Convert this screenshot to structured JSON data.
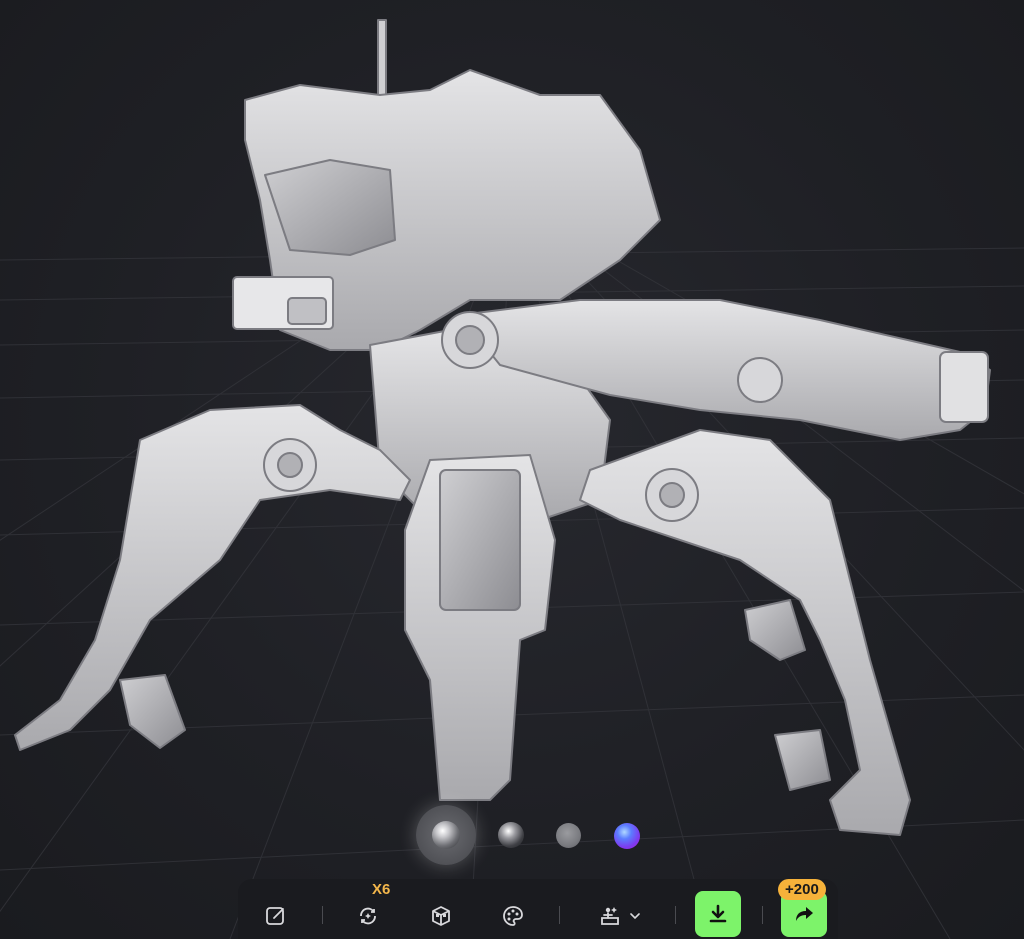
{
  "viewer": {
    "background_color": "#1f2025",
    "grid_color": "#2f3036"
  },
  "materials": [
    {
      "name": "clay",
      "icon": "clay-sphere-icon",
      "active": true
    },
    {
      "name": "metal",
      "icon": "metal-sphere-icon",
      "active": false
    },
    {
      "name": "matte",
      "icon": "matte-sphere-icon",
      "active": false
    },
    {
      "name": "rainbow",
      "icon": "rainbow-sphere-icon",
      "active": false
    }
  ],
  "toolbar": {
    "edit_icon": "edit-icon",
    "remesh_icon": "remesh-icon",
    "remesh_count": "X6",
    "cube_icon": "cube-icon",
    "texture_icon": "palette-icon",
    "rig_icon": "rig-icon",
    "rig_dropdown_icon": "chevron-down-icon",
    "download_icon": "download-icon",
    "share_icon": "share-arrow-icon",
    "share_badge": "+200",
    "accent_green": "#7df36a",
    "accent_orange": "#f6b23a"
  }
}
